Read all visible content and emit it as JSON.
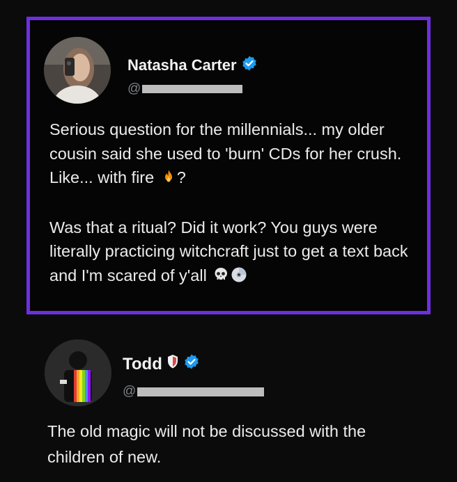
{
  "post1": {
    "display_name": "Natasha Carter",
    "handle_prefix": "@",
    "text_line1": "Serious question for the millennials... my older cousin said she used to 'burn' CDs for her crush. Like... with fire",
    "text_line1_end": "?",
    "text_para2": "Was that a ritual? Did it work? You guys were literally practicing witchcraft just to get a text back and I'm scared of y'all",
    "emoji_fire": "fire-emoji",
    "emoji_skull": "skull-emoji",
    "emoji_disc": "disc-emoji"
  },
  "post2": {
    "display_name": "Todd",
    "handle_prefix": "@",
    "text": "The old magic will not be discussed with the children of new."
  },
  "colors": {
    "highlight_border": "#6d2fe0",
    "verified_blue": "#1d9bf0",
    "background": "#0b0b0c"
  }
}
